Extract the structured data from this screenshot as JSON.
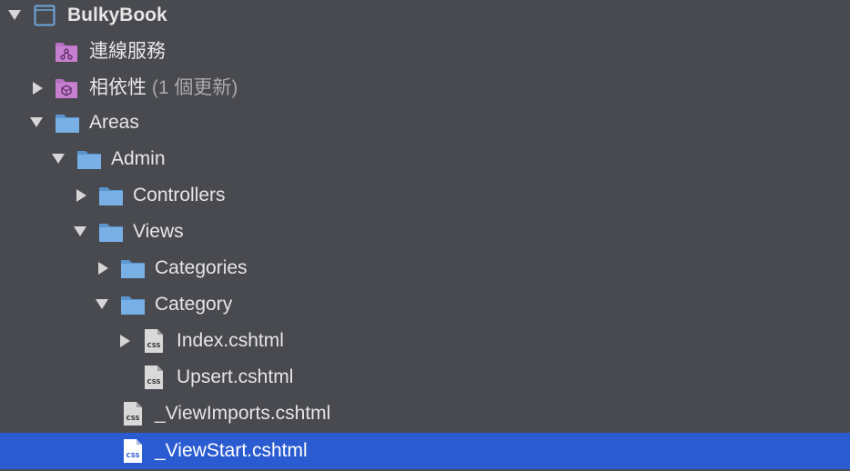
{
  "tree": {
    "project": {
      "label": "BulkyBook",
      "icon": "project-icon"
    },
    "connected_services": {
      "label": "連線服務",
      "icon": "connected-services-icon"
    },
    "dependencies": {
      "label": "相依性",
      "note": "(1 個更新)",
      "icon": "dependencies-icon"
    },
    "areas": {
      "label": "Areas",
      "icon": "folder-icon"
    },
    "admin": {
      "label": "Admin",
      "icon": "folder-icon"
    },
    "controllers": {
      "label": "Controllers",
      "icon": "folder-icon"
    },
    "views": {
      "label": "Views",
      "icon": "folder-icon"
    },
    "categories": {
      "label": "Categories",
      "icon": "folder-icon"
    },
    "category": {
      "label": "Category",
      "icon": "folder-icon"
    },
    "index": {
      "label": "Index.cshtml",
      "icon": "css-file-icon",
      "icon_text": "CSS"
    },
    "upsert": {
      "label": "Upsert.cshtml",
      "icon": "css-file-icon",
      "icon_text": "CSS"
    },
    "viewimports": {
      "label": "_ViewImports.cshtml",
      "icon": "css-file-icon",
      "icon_text": "CSS"
    },
    "viewstart": {
      "label": "_ViewStart.cshtml",
      "icon": "css-file-icon",
      "icon_text": "CSS",
      "selected": true
    }
  },
  "colors": {
    "background": "#484a4f",
    "selection": "#2a5bd0",
    "folder": "#6ea6dc",
    "puzzle": "#c77fd0"
  }
}
